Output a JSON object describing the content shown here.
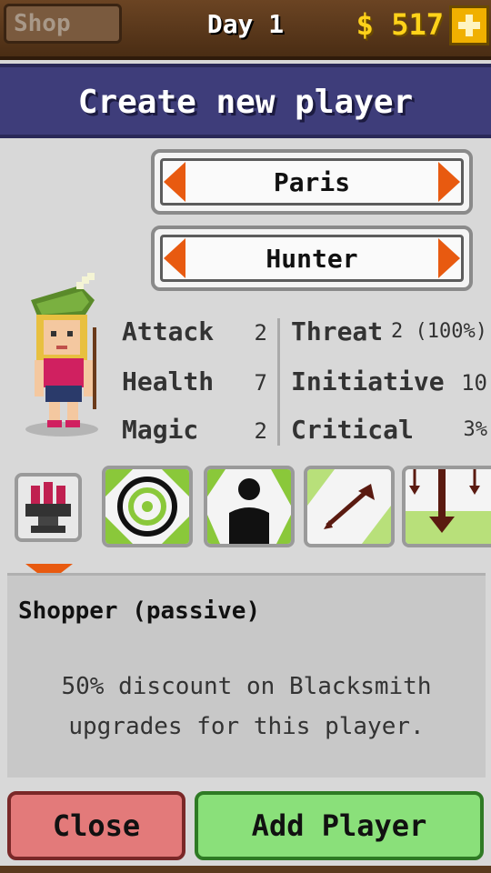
{
  "topbar": {
    "shop_label": "Shop",
    "day_label": "Day 1",
    "gold": "$ 517"
  },
  "dialog": {
    "title": "Create new player",
    "name_selector": "Paris",
    "class_selector": "Hunter"
  },
  "stats": {
    "attack_label": "Attack",
    "attack_value": "2",
    "health_label": "Health",
    "health_value": "7",
    "magic_label": "Magic",
    "magic_value": "2",
    "threat_label": "Threat",
    "threat_value": "2 (100%)",
    "initiative_label": "Initiative",
    "initiative_value": "10",
    "critical_label": "Critical",
    "critical_value": "3%"
  },
  "skills": [
    {
      "icon": "anvil-icon"
    },
    {
      "icon": "target-icon"
    },
    {
      "icon": "silhouette-icon"
    },
    {
      "icon": "arrow-icon"
    },
    {
      "icon": "down-arrows-icon"
    }
  ],
  "description": {
    "title": "Shopper (passive)",
    "text": "50% discount on Blacksmith\nupgrades for this player."
  },
  "buttons": {
    "close": "Close",
    "add": "Add Player"
  },
  "colors": {
    "accent_orange": "#e85a10",
    "title_bar": "#3e3d7a",
    "close_button": "#e37a7a",
    "add_button": "#8ae07a",
    "gold_text": "#ffd21a"
  }
}
